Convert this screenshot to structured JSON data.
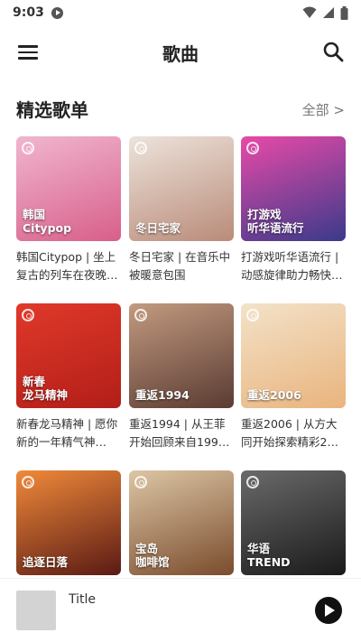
{
  "status": {
    "time": "9:03"
  },
  "appbar": {
    "title": "歌曲"
  },
  "section": {
    "title": "精选歌单",
    "more_label": "全部 >"
  },
  "playlists": [
    {
      "cover_label": "韩国\nCitypop",
      "desc": "韩国Citypop | 坐上复古的列车在夜晚…",
      "colors": [
        "#f0b6cf",
        "#d85f8a"
      ]
    },
    {
      "cover_label": "冬日宅家",
      "desc": "冬日宅家 | 在音乐中被暖意包围",
      "colors": [
        "#ede3db",
        "#b98b79"
      ]
    },
    {
      "cover_label": "打游戏\n听华语流行",
      "desc": "打游戏听华语流行 | 动感旋律助力畅快…",
      "colors": [
        "#e84aa8",
        "#3a3a8a"
      ]
    },
    {
      "cover_label": "新春\n龙马精神",
      "desc": "新春龙马精神 | 愿你新的一年精气神…",
      "colors": [
        "#e0392a",
        "#b21e18"
      ]
    },
    {
      "cover_label": "重返1994",
      "desc": "重返1994 | 从王菲开始回顾来自199…",
      "colors": [
        "#c29a7f",
        "#5a3b33"
      ]
    },
    {
      "cover_label": "重返2006",
      "desc": "重返2006 | 从方大同开始探索精彩2…",
      "colors": [
        "#f3e2c9",
        "#e9b47d"
      ]
    },
    {
      "cover_label": "追逐日落",
      "desc": "",
      "colors": [
        "#f08a3a",
        "#5a1a14"
      ]
    },
    {
      "cover_label": "宝岛\n咖啡馆",
      "desc": "",
      "colors": [
        "#dcc6a5",
        "#7a4c2d"
      ]
    },
    {
      "cover_label": "华语\nTREND",
      "desc": "",
      "colors": [
        "#6a6a6a",
        "#1a1a1a"
      ]
    }
  ],
  "player": {
    "title": "Title"
  }
}
